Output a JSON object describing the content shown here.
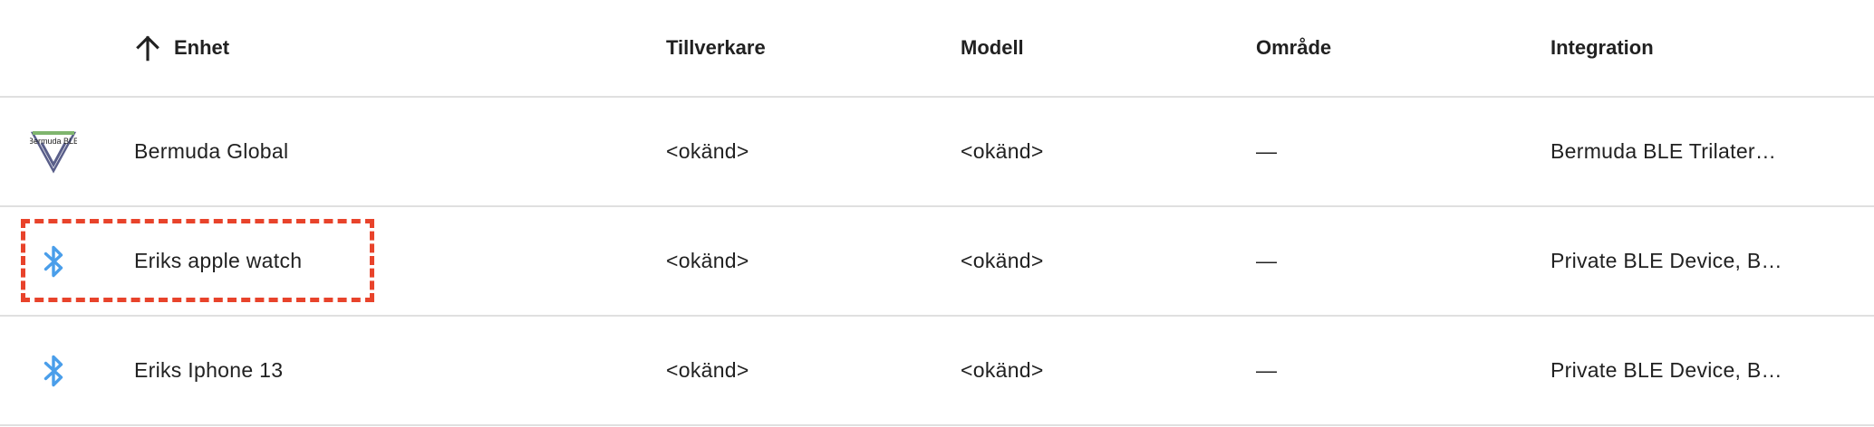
{
  "header": {
    "columns": [
      {
        "label": "Enhet",
        "sorted": "ascending"
      },
      {
        "label": "Tillverkare"
      },
      {
        "label": "Modell"
      },
      {
        "label": "Område"
      },
      {
        "label": "Integration"
      }
    ]
  },
  "rows": [
    {
      "icon": "bermuda-logo-icon",
      "icon_text": "Bermuda BLE",
      "name": "Bermuda Global",
      "manufacturer": "<okänd>",
      "model": "<okänd>",
      "area": "—",
      "integration": "Bermuda BLE Trilater…"
    },
    {
      "icon": "bluetooth-icon",
      "name": "Eriks apple watch",
      "manufacturer": "<okänd>",
      "model": "<okänd>",
      "area": "—",
      "integration": "Private BLE Device, B…",
      "highlighted": true
    },
    {
      "icon": "bluetooth-icon",
      "name": "Eriks Iphone 13",
      "manufacturer": "<okänd>",
      "model": "<okänd>",
      "area": "—",
      "integration": "Private BLE Device, B…"
    }
  ],
  "colors": {
    "bluetooth": "#4a9eea",
    "highlight": "#e8432b",
    "divider": "#e0e0e0"
  }
}
